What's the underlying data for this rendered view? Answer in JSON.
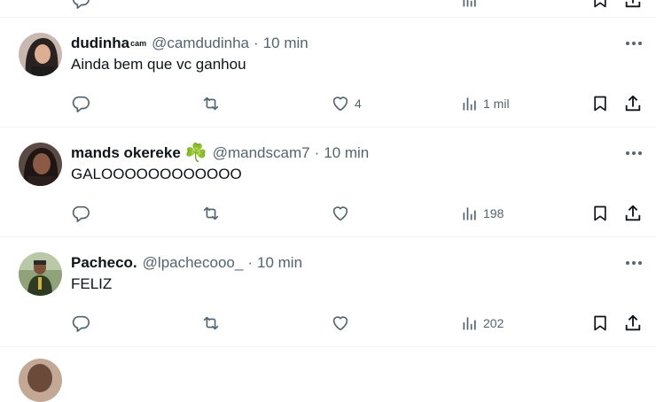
{
  "tweets": [
    {
      "name": "dudinha",
      "name_suffix": "cam",
      "handle": "@camdudinha",
      "time": "10 min",
      "text": "Ainda bem que vc ganhou",
      "likes": "4",
      "views": "1 mil"
    },
    {
      "name": "mands okereke",
      "name_emoji": "☘️",
      "handle": "@mandscam7",
      "time": "10 min",
      "text": "GALOOOOOOOOOOOO",
      "likes": "",
      "views": "198"
    },
    {
      "name": "Pacheco.",
      "handle": "@lpachecooo_",
      "time": "10 min",
      "text": "FELIZ",
      "likes": "",
      "views": "202"
    }
  ],
  "separator": "·",
  "icons": {
    "reply": "reply-icon",
    "retweet": "retweet-icon",
    "like": "heart-icon",
    "views": "views-chart-icon",
    "bookmark": "bookmark-icon",
    "share": "share-icon",
    "more": "more-dots-icon"
  },
  "colors": {
    "text": "#0f1419",
    "secondary": "#536471",
    "divider": "#eff3f4"
  }
}
